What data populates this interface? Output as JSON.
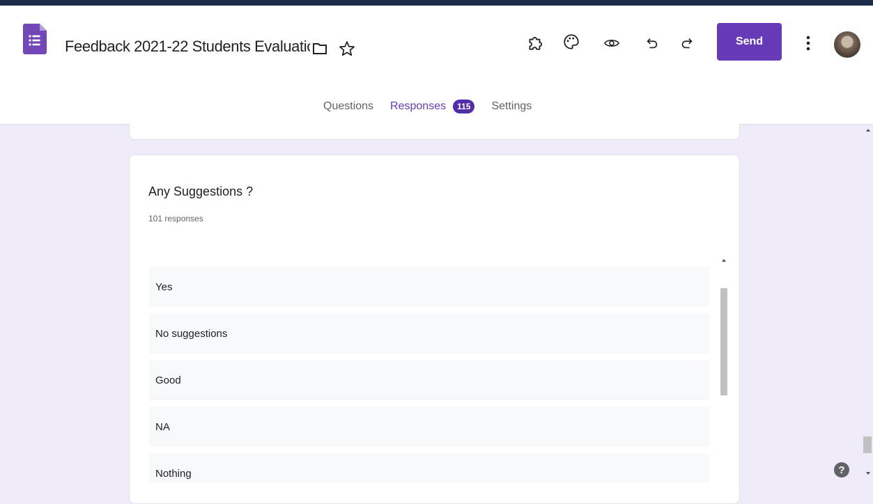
{
  "form": {
    "title": "Feedback 2021-22 Students Evaluatic",
    "send_label": "Send"
  },
  "header_icons": [
    "google-forms-icon",
    "folder-icon",
    "star-icon",
    "add-on-icon",
    "palette-icon",
    "preview-eye-icon",
    "undo-icon",
    "redo-icon",
    "more-vert-icon",
    "avatar"
  ],
  "tabs": [
    {
      "label": "Questions"
    },
    {
      "label": "Responses",
      "badge": "115"
    },
    {
      "label": "Settings"
    }
  ],
  "question": {
    "title": "Any Suggestions ?",
    "count": "101 responses",
    "responses": [
      "Yes",
      "No suggestions",
      "Good",
      "NA",
      "Nothing"
    ]
  },
  "colors": {
    "accent": "#673ab7",
    "badge": "#512da8",
    "page_bg": "#f0ebf8",
    "top_strip": "#1c2b4a"
  }
}
